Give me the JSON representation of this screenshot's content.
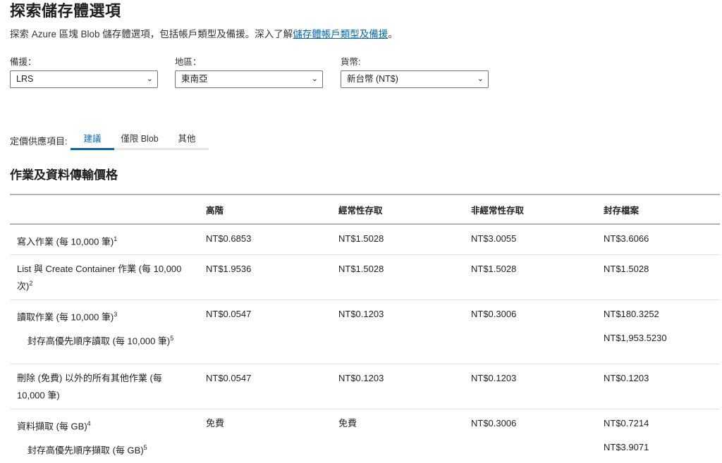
{
  "page": {
    "title": "探索儲存體選項",
    "description_prefix": "探索 Azure 區塊 Blob 儲存體選項，包括帳戶類型及備援。深入了解",
    "description_link": "儲存體帳戶類型及備援",
    "description_suffix": "。"
  },
  "filters": {
    "redundancy": {
      "label": "備援：",
      "value": "LRS"
    },
    "region": {
      "label": "地區：",
      "value": "東南亞"
    },
    "currency": {
      "label": "貨幣:",
      "value": "新台幣 (NT$)"
    }
  },
  "tabs": {
    "label": "定價供應項目:",
    "items": [
      "建議",
      "僅限 Blob",
      "其他"
    ],
    "active": "建議"
  },
  "section": {
    "title": "作業及資料傳輸價格"
  },
  "table": {
    "headers": [
      "",
      "高階",
      "經常性存取",
      "非經常性存取",
      "封存檔案"
    ],
    "rows": [
      {
        "name": "寫入作業 (每 10,000 筆)",
        "sup": "1",
        "values": [
          "NT$0.6853",
          "NT$1.5028",
          "NT$3.0055",
          "NT$3.6066"
        ]
      },
      {
        "name": "List 與 Create Container 作業 (每 10,000 次)",
        "sup": "2",
        "values": [
          "NT$1.9536",
          "NT$1.5028",
          "NT$1.5028",
          "NT$1.5028"
        ]
      },
      {
        "name": "讀取作業 (每 10,000 筆)",
        "sup": "3",
        "values": [
          "NT$0.0547",
          "NT$0.1203",
          "NT$0.3006",
          "NT$180.3252"
        ]
      },
      {
        "name": "封存高優先順序讀取 (每 10,000 筆)",
        "sup": "5",
        "values": [
          "",
          "",
          "",
          "NT$1,953.5230"
        ]
      },
      {
        "name": "刪除 (免費) 以外的所有其他作業 (每 10,000 筆)",
        "sup": "",
        "values": [
          "NT$0.0547",
          "NT$0.1203",
          "NT$0.1203",
          "NT$0.1203"
        ]
      },
      {
        "name": "資料擷取 (每 GB)",
        "sup": "4",
        "values": [
          "免費",
          "免費",
          "NT$0.3006",
          "NT$0.7214"
        ]
      },
      {
        "name": "封存高優先順序擷取 (每 GB)",
        "sup": "5",
        "values": [
          "",
          "",
          "",
          "NT$3.9071"
        ]
      }
    ]
  }
}
